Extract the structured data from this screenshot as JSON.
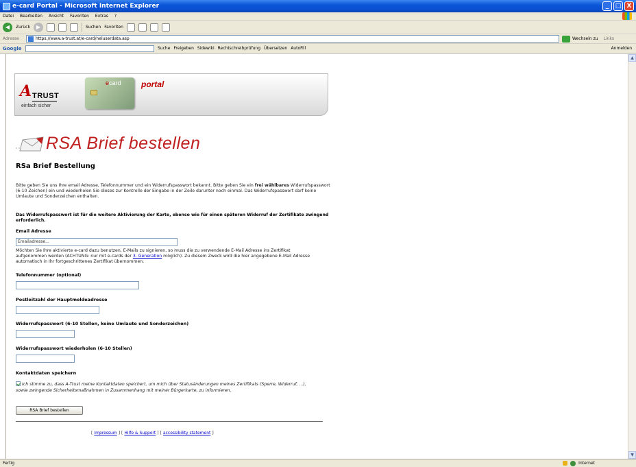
{
  "window": {
    "title": "e-card Portal - Microsoft Internet Explorer",
    "buttons": [
      "_",
      "□",
      "X"
    ]
  },
  "menubar": {
    "items": [
      "Datei",
      "Bearbeiten",
      "Ansicht",
      "Favoriten",
      "Extras",
      "?"
    ]
  },
  "toolbar": {
    "back_label": "Zurück",
    "search_label": "Suchen",
    "favorites_label": "Favoriten"
  },
  "addressbar": {
    "label": "Adresse",
    "url": "https://www.a-trust.at/e-card/neluserdata.asp",
    "go_label": "Wechseln zu",
    "links_label": "Links"
  },
  "googlebar": {
    "logo": "Google",
    "items": [
      "Suche",
      "Freigeben",
      "Sidewiki",
      "Rechtschreibprüfung",
      "Übersetzen",
      "AutoFill"
    ],
    "right_label": "Anmelden"
  },
  "banner": {
    "logo_letter": "A",
    "logo_word": "TRUST",
    "tagline": "einfach sicher",
    "card_text_prefix": "e",
    "card_text": "card",
    "portal_word": "portal"
  },
  "page": {
    "title": "RSA Brief bestellen",
    "subtitle": "RSa Brief Bestellung",
    "intro_part1": "Bitte geben Sie uns Ihre email Adresse, Telefonnummer und ein Widerrufspasswort bekannt. Bitte geben Sie ein ",
    "intro_bold": "frei wählbares",
    "intro_part2": " Widerrufspasswort (6-10 Zeichen) ein und wiederholen Sie dieses zur Kontrolle der Eingabe in der Zeile darunter noch einmal. Das Widerrufspasswort darf keine Umlaute und Sonderzeichen enthalten.",
    "note": "Das Widerrufspasswort ist für die weitere Aktivierung der Karte, ebenso wie für einen späteren Widerruf der Zertifikate zwingend erforderlich.",
    "email_label": "Email Adresse",
    "email_value": "Emailadresse...",
    "email_help_part1": "Möchten Sie Ihre aktivierte e-card dazu benutzen, E-Mails zu signieren, so muss die zu verwendende E-Mail Adresse ins Zertifikat aufgenommen werden (ACHTUNG: nur mit e-cards der ",
    "email_help_link": "3. Generation",
    "email_help_part2": " möglich). Zu diesem Zweck wird die hier angegebene E-Mail Adresse automatisch in Ihr fortgeschrittenes Zertifikat übernommen.",
    "phone_label": "Telefonnummer (optional)",
    "postal_label": "Postleitzahl der Hauptmeldeadresse",
    "password_label": "Widerrufspasswort (6-10 Stellen, keine Umlaute und Sonderzeichen)",
    "password_repeat_label": "Widerrufspasswort wiederholen (6-10 Stellen)",
    "save_contact_label": "Kontaktdaten speichern",
    "consent_text": "Ich stimme zu, dass A-Trust meine Kontaktdaten speichert, um mich über Statusänderungen meines Zertifikats (Sperre, Widerruf, ...), sowie zwingende Sicherheitsmaßnahmen in Zusammenhang mit meiner Bürgerkarte, zu informieren.",
    "consent_checked": true,
    "submit_label": "RSA Brief bestellen"
  },
  "footer": {
    "links": [
      "Impressum",
      "Hilfe & Support",
      "accessibility statement"
    ]
  },
  "statusbar": {
    "left": "Fertig",
    "right": "Internet"
  }
}
